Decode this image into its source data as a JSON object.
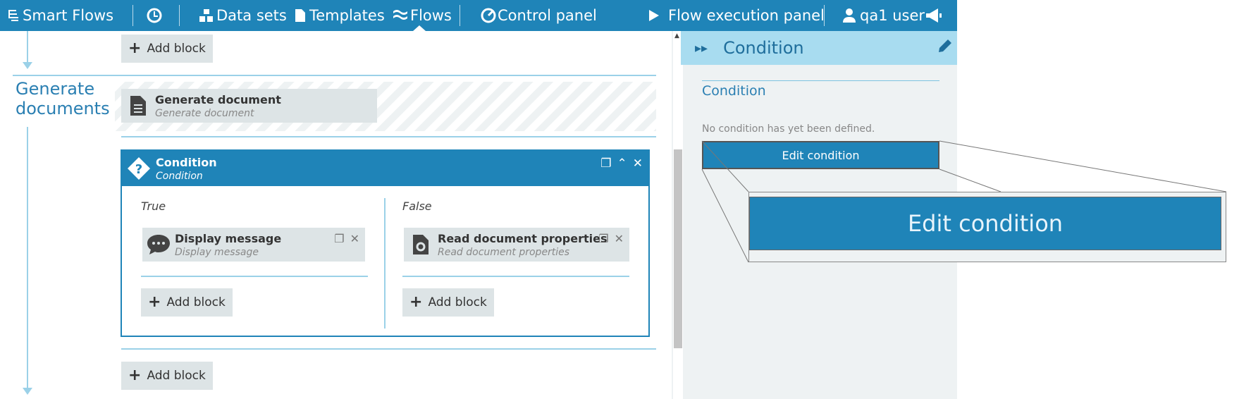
{
  "nav": {
    "brand": "Smart Flows",
    "datasets": "Data sets",
    "templates": "Templates",
    "flows": "Flows",
    "control_panel": "Control panel",
    "flow_execution": "Flow execution panel",
    "user": "qa1 user"
  },
  "canvas": {
    "add_block": "Add block",
    "section_title_line1": "Generate",
    "section_title_line2": "documents",
    "generate_block": {
      "title": "Generate document",
      "subtitle": "Generate document"
    },
    "condition_block": {
      "title": "Condition",
      "subtitle": "Condition",
      "true_label": "True",
      "false_label": "False",
      "true_branch": {
        "title": "Display message",
        "subtitle": "Display message"
      },
      "false_branch": {
        "title": "Read document properties",
        "subtitle": "Read document properties"
      }
    }
  },
  "panel": {
    "title": "Condition",
    "section": "Condition",
    "note": "No condition has yet been defined.",
    "edit_button": "Edit condition",
    "zoom_label": "Edit condition"
  },
  "colors": {
    "primary": "#1f84b8",
    "panel_header": "#a8dcf0",
    "panel_bg": "#eef2f3",
    "block_bg": "#dde4e6"
  }
}
